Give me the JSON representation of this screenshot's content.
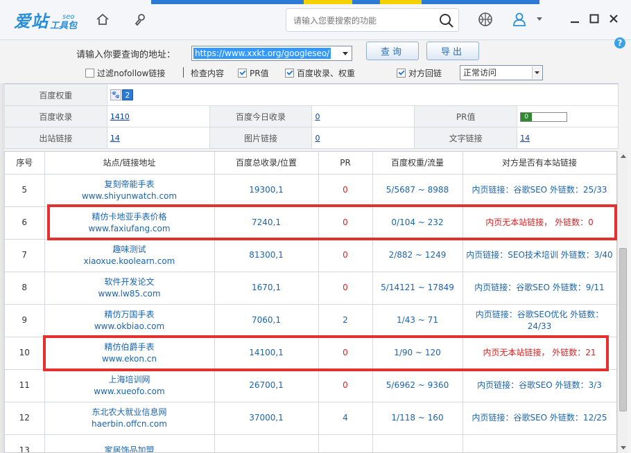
{
  "app": {
    "logo_main": "爱站",
    "logo_seo": "seo",
    "logo_sub": "工具包",
    "search_placeholder": "请输入您要搜索的功能"
  },
  "query": {
    "label": "请输入你要查询的地址：",
    "url": "https://www.xxkt.org/googleseo/",
    "query_button": "查询",
    "export_button": "导出",
    "options": [
      {
        "label": "过滤nofollow链接",
        "checked": false
      },
      {
        "label": "检查内容",
        "checked": false
      },
      {
        "label": "PR值",
        "checked": true
      },
      {
        "label": "百度收录、权重",
        "checked": true
      },
      {
        "label": "对方回链",
        "checked": true
      }
    ],
    "access_mode": "正常访问"
  },
  "info": {
    "baidu_weight_label": "百度权重",
    "baidu_weight_value": "2",
    "baidu_index_label": "百度收录",
    "baidu_index_value": "1410",
    "baidu_today_label": "百度今日收录",
    "baidu_today_value": "0",
    "pr_label": "PR值",
    "pr_value": "0",
    "outlinks_label": "出站链接",
    "outlinks_value": "14",
    "img_links_label": "图片链接",
    "img_links_value": "0",
    "text_links_label": "文字链接",
    "text_links_value": "14"
  },
  "table": {
    "headers": [
      "序号",
      "站点/链接地址",
      "百度总收录/位置",
      "PR",
      "百度权重/流量",
      "对方是否有本站链接"
    ],
    "rows": [
      {
        "no": "5",
        "name": "复刻帝能手表",
        "url": "www.shiyunwatch.com",
        "index": "19300,1",
        "pr": "0",
        "weight": "5/5687 ~ 8988",
        "rel": "内页链接：谷歌SEO  外链数：25/33",
        "nolink": false
      },
      {
        "no": "6",
        "name": "精仿卡地亚手表价格",
        "url": "www.faxiufang.com",
        "index": "7240,1",
        "pr": "0",
        "weight": "0/104 ~ 232",
        "rel": "内页无本站链接， 外链数：0",
        "nolink": true
      },
      {
        "no": "7",
        "name": "趣味测试",
        "url": "xiaoxue.koolearn.com",
        "index": "81300,1",
        "pr": "0",
        "weight": "2/882 ~ 1249",
        "rel": "内页链接：SEO技术培训  外链数：3/40",
        "nolink": false
      },
      {
        "no": "8",
        "name": "软件开发论文",
        "url": "www.lw85.com",
        "index": "1670,1",
        "pr": "0",
        "weight": "5/14121 ~ 17849",
        "rel": "内页链接：谷歌SEO  外链数：9/11",
        "nolink": false
      },
      {
        "no": "9",
        "name": "精仿万国手表",
        "url": "www.okbiao.com",
        "index": "7060,1",
        "pr": "2",
        "weight": "1/43 ~ 71",
        "rel": "内页链接：谷歌SEO优化  外链数：24/33",
        "nolink": false
      },
      {
        "no": "10",
        "name": "精仿伯爵手表",
        "url": "www.ekon.cn",
        "index": "14100,1",
        "pr": "0",
        "weight": "1/90 ~ 120",
        "rel": "内页无本站链接， 外链数：21",
        "nolink": true
      },
      {
        "no": "11",
        "name": "上海培训网",
        "url": "www.xueofo.com",
        "index": "26700,1",
        "pr": "0",
        "weight": "5/6962 ~ 9360",
        "rel": "内页链接：谷歌SEO  外链数：3/3",
        "nolink": false
      },
      {
        "no": "12",
        "name": "东北农大就业信息网",
        "url": "haerbin.offcn.com",
        "index": "37000,1",
        "pr": "4",
        "weight": "1/118 ~ 160",
        "rel": "内页链接：谷歌SEO  外链数：12/25",
        "nolink": false
      },
      {
        "no": "13",
        "name": "家居饰品加盟",
        "url": "",
        "index": "",
        "pr": "",
        "weight": "",
        "rel": "",
        "nolink": false
      }
    ]
  },
  "colors": {
    "brand": "#2a8fd8",
    "link_blue": "#1a64b0",
    "alert_red": "#e02020",
    "highlight_box": "#e53030"
  }
}
